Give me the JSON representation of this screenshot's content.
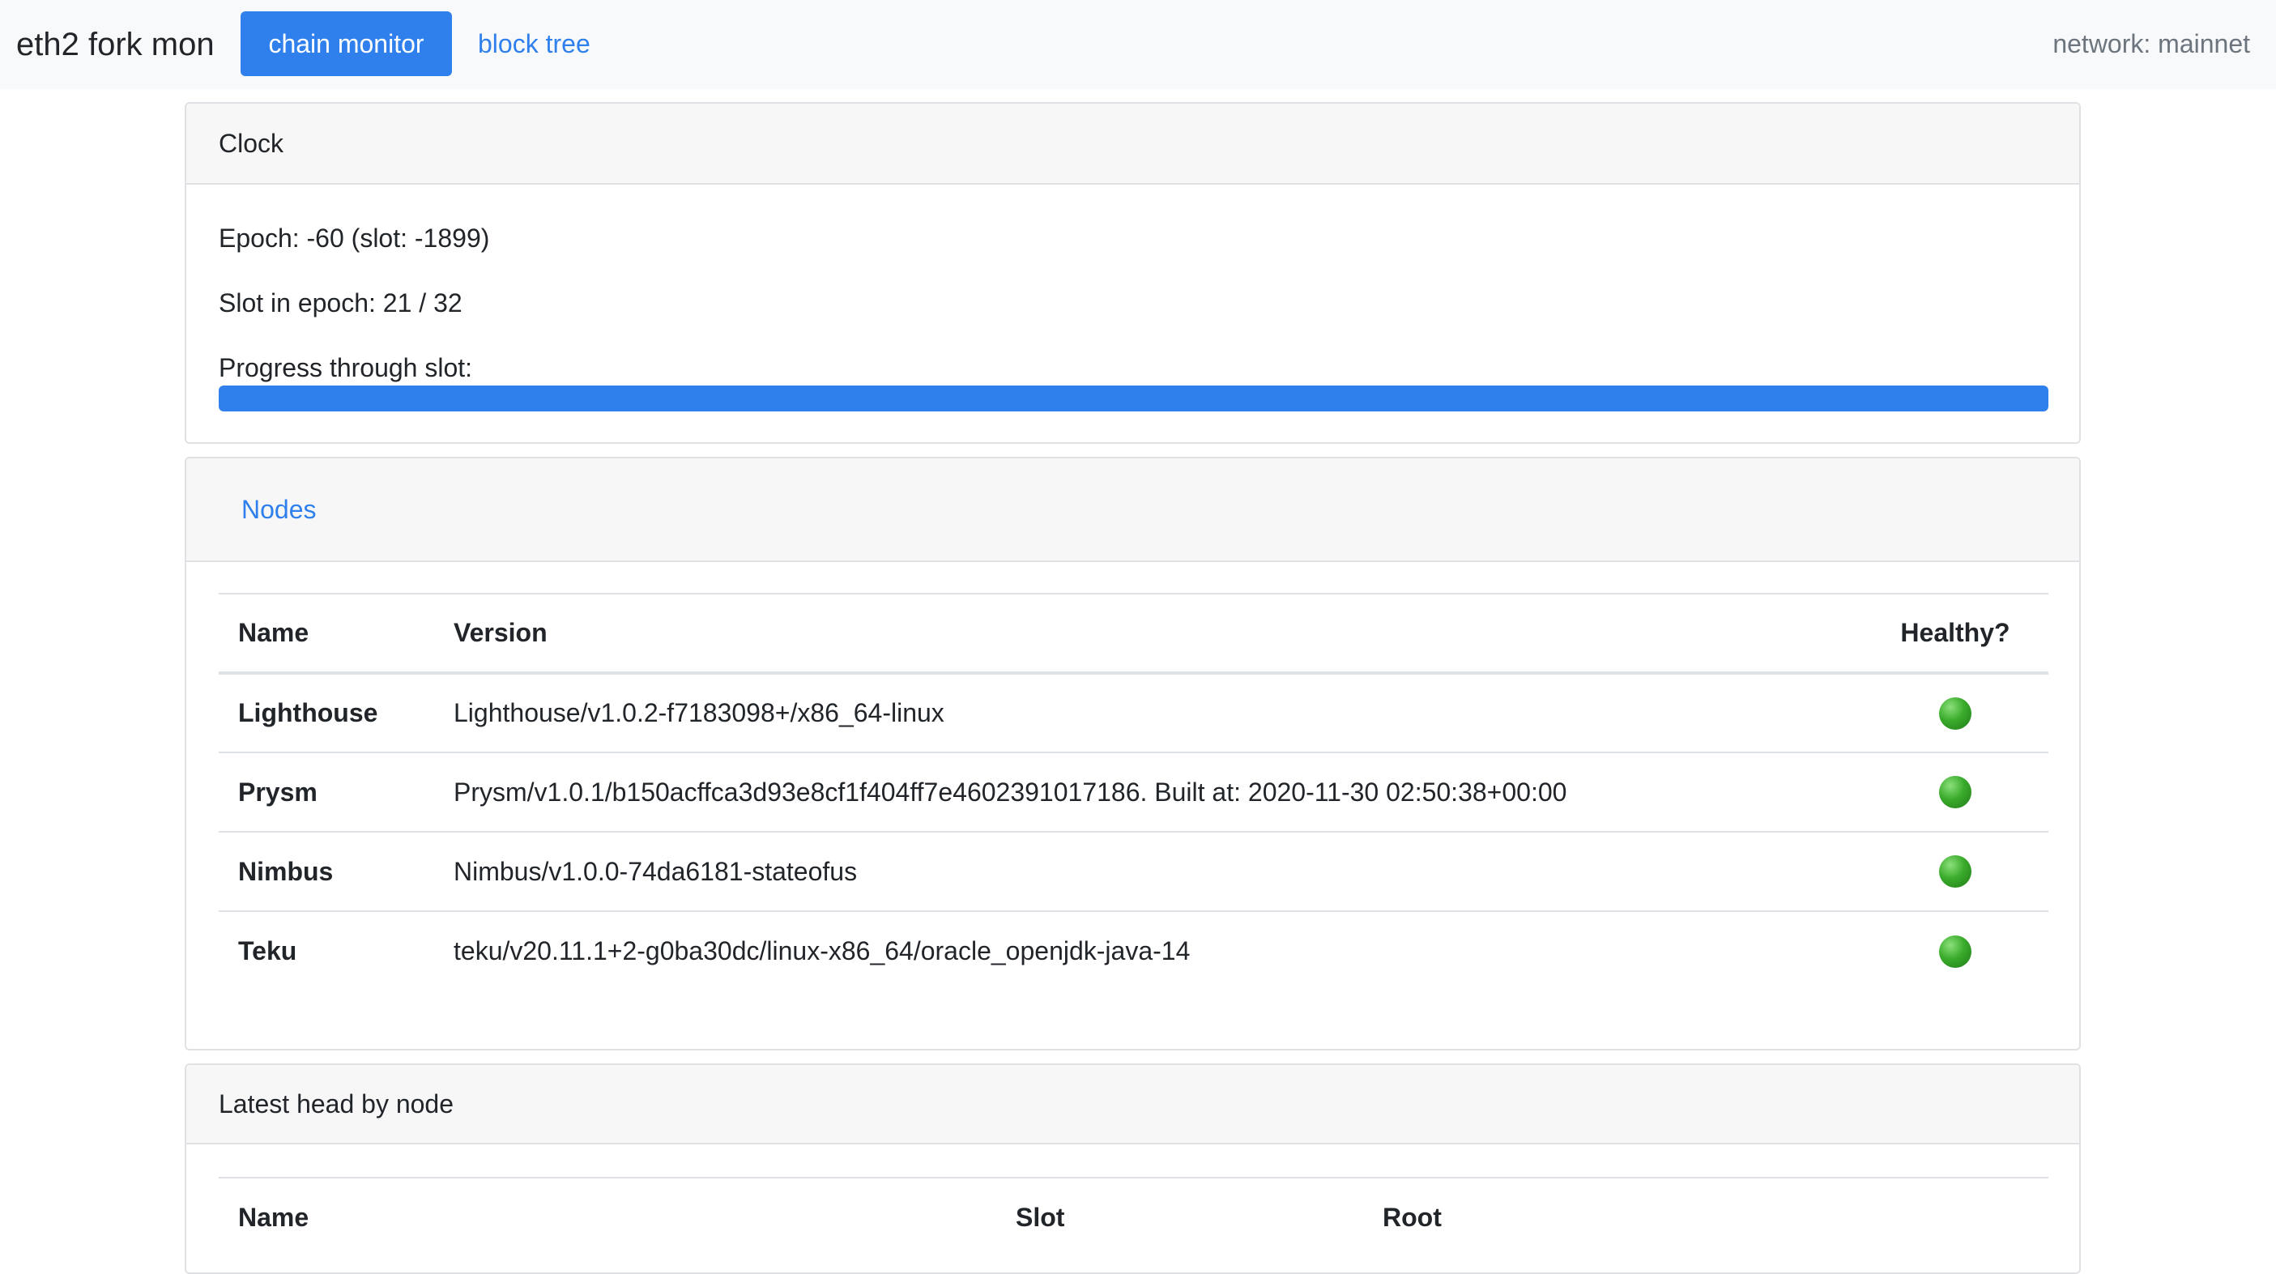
{
  "navbar": {
    "brand": "eth2 fork mon",
    "tabs": [
      {
        "label": "chain monitor",
        "active": true
      },
      {
        "label": "block tree",
        "active": false
      }
    ],
    "network": "network: mainnet"
  },
  "clock": {
    "title": "Clock",
    "epoch_line": "Epoch: -60 (slot: -1899)",
    "slot_in_epoch_line": "Slot in epoch: 21 / 32",
    "progress_label": "Progress through slot:",
    "progress_fraction": 1.0
  },
  "nodes": {
    "tab_label": "Nodes",
    "columns": [
      "Name",
      "Version",
      "Healthy?"
    ],
    "rows": [
      {
        "name": "Lighthouse",
        "version": "Lighthouse/v1.0.2-f7183098+/x86_64-linux",
        "healthy": true
      },
      {
        "name": "Prysm",
        "version": "Prysm/v1.0.1/b150acffca3d93e8cf1f404ff7e4602391017186. Built at: 2020-11-30 02:50:38+00:00",
        "healthy": true
      },
      {
        "name": "Nimbus",
        "version": "Nimbus/v1.0.0-74da6181-stateofus",
        "healthy": true
      },
      {
        "name": "Teku",
        "version": "teku/v20.11.1+2-g0ba30dc/linux-x86_64/oracle_openjdk-java-14",
        "healthy": true
      }
    ]
  },
  "heads": {
    "title": "Latest head by node",
    "columns": [
      "Name",
      "Slot",
      "Root"
    ]
  },
  "colors": {
    "accent": "#2f80ed",
    "healthy": "#3aab2c",
    "navbar_bg": "#f8f9fa",
    "muted_text": "#6c757d"
  },
  "icons": {
    "health_indicator": "green-circle-icon"
  }
}
